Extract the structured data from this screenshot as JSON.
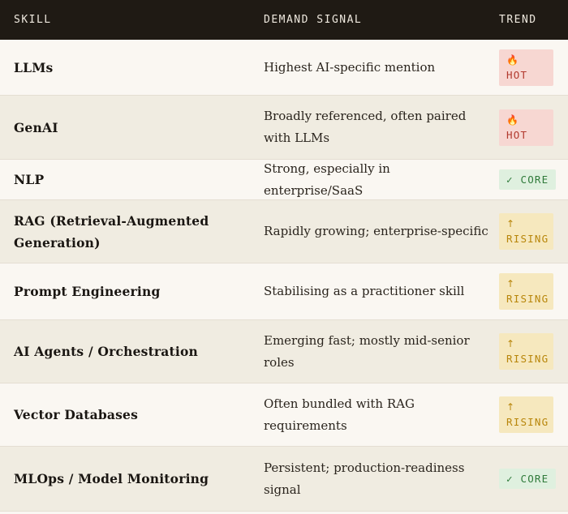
{
  "header": {
    "skill": "SKILL",
    "signal": "DEMAND SIGNAL",
    "trend": "TREND"
  },
  "rows": [
    {
      "skill": "LLMs",
      "signal": "Highest AI-specific mention",
      "trend": {
        "type": "hot",
        "icon": "🔥",
        "label": "HOT"
      }
    },
    {
      "skill": "GenAI",
      "signal": "Broadly referenced, often paired with LLMs",
      "trend": {
        "type": "hot",
        "icon": "🔥",
        "label": "HOT"
      }
    },
    {
      "skill": "NLP",
      "signal": "Strong, especially in enterprise/SaaS",
      "trend": {
        "type": "core",
        "icon": "✓",
        "label": "CORE"
      }
    },
    {
      "skill": "RAG (Retrieval-Augmented Generation)",
      "signal": "Rapidly growing; enterprise-specific",
      "trend": {
        "type": "rising",
        "icon": "↑",
        "label": "RISING"
      }
    },
    {
      "skill": "Prompt Engineering",
      "signal": "Stabilising as a practitioner skill",
      "trend": {
        "type": "rising",
        "icon": "↑",
        "label": "RISING"
      }
    },
    {
      "skill": "AI Agents / Orchestration",
      "signal": "Emerging fast; mostly mid-senior roles",
      "trend": {
        "type": "rising",
        "icon": "↑",
        "label": "RISING"
      }
    },
    {
      "skill": "Vector Databases",
      "signal": "Often bundled with RAG requirements",
      "trend": {
        "type": "rising",
        "icon": "↑",
        "label": "RISING"
      }
    },
    {
      "skill": "MLOps / Model Monitoring",
      "signal": "Persistent; production-readiness signal",
      "trend": {
        "type": "core",
        "icon": "✓",
        "label": "CORE"
      }
    }
  ]
}
